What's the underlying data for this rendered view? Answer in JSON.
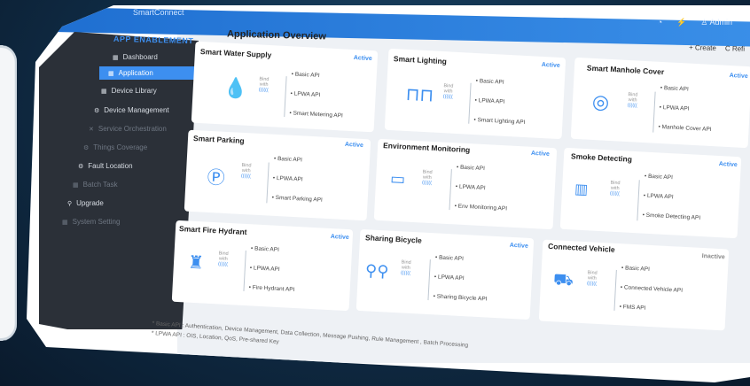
{
  "app": {
    "brand": "SmartConnect",
    "top_icons": [
      "bell-icon",
      "bulb-icon",
      "user-icon"
    ],
    "user_label": "Admin"
  },
  "sidebar": {
    "title": "APP ENABLEMENT",
    "items": [
      {
        "label": "Dashboard",
        "icon": "grid-icon",
        "state": "normal"
      },
      {
        "label": "Application",
        "icon": "grid-icon",
        "state": "active"
      },
      {
        "label": "Device Library",
        "icon": "grid-icon",
        "state": "normal"
      },
      {
        "label": "Device Management",
        "icon": "gear-icon",
        "state": "normal"
      },
      {
        "label": "Service Orchestration",
        "icon": "cross-icon",
        "state": "dim"
      },
      {
        "label": "Things Coverage",
        "icon": "gear-icon",
        "state": "dim"
      },
      {
        "label": "Fault Location",
        "icon": "gear-icon",
        "state": "normal"
      },
      {
        "label": "Batch Task",
        "icon": "grid-icon",
        "state": "dim"
      },
      {
        "label": "Upgrade",
        "icon": "pin-icon",
        "state": "normal"
      },
      {
        "label": "System Setting",
        "icon": "grid-icon",
        "state": "dim"
      }
    ]
  },
  "main": {
    "title": "Application Overview",
    "create_label": "+ Create",
    "refresh_label": "C Refi"
  },
  "bind_label": {
    "line1": "Bind",
    "line2": "with",
    "line3": "(((((("
  },
  "cards": [
    {
      "title": "Smart Water Supply",
      "status": "Active",
      "icon": "water-drop-icon",
      "apis": [
        "• Basic API",
        "• LPWA API",
        "• Smart Metering API"
      ]
    },
    {
      "title": "Smart Lighting",
      "status": "Active",
      "icon": "streetlight-icon",
      "apis": [
        "• Basic API",
        "• LPWA API",
        "• Smart Lighting API"
      ]
    },
    {
      "title": "Smart Manhole Cover",
      "status": "Active",
      "icon": "manhole-icon",
      "apis": [
        "• Basic API",
        "• LPWA API",
        "• Manhole Cover API"
      ]
    },
    {
      "title": "Smart Parking",
      "status": "Active",
      "icon": "parking-icon",
      "apis": [
        "• Basic API",
        "• LPWA API",
        "• Smart Parking API"
      ]
    },
    {
      "title": "Environment Monitoring",
      "status": "Active",
      "icon": "monitor-leaf-icon",
      "apis": [
        "• Basic API",
        "• LPWA API",
        "• Env Monitoring API"
      ]
    },
    {
      "title": "Smoke Detecting",
      "status": "Active",
      "icon": "smoke-detector-icon",
      "apis": [
        "• Basic API",
        "• LPWA API",
        "• Smoke Detecting API"
      ]
    },
    {
      "title": "Smart Fire Hydrant",
      "status": "Active",
      "icon": "fire-hydrant-icon",
      "apis": [
        "• Basic API",
        "• LPWA API",
        "• Fire Hydrant API"
      ]
    },
    {
      "title": "Sharing Bicycle",
      "status": "Active",
      "icon": "bicycle-icon",
      "apis": [
        "• Basic API",
        "• LPWA API",
        "• Sharing Bicycle API"
      ]
    },
    {
      "title": "Connected Vehicle",
      "status": "Inactive",
      "icon": "car-icon",
      "apis": [
        "• Basic API",
        "• Connected Vehicle API",
        "• FMS API"
      ]
    }
  ],
  "footer": {
    "line1": "* Basic API : Authentication, Device Management, Data Collection, Message Pushing, Rule Management , Batch Processing",
    "line2": "* LPWA API : OIS, Location, QoS, Pre-shared Key"
  },
  "colors": {
    "accent": "#3d8ff0",
    "sidebar": "#2b3038",
    "topbar": "#1f6fd1"
  }
}
